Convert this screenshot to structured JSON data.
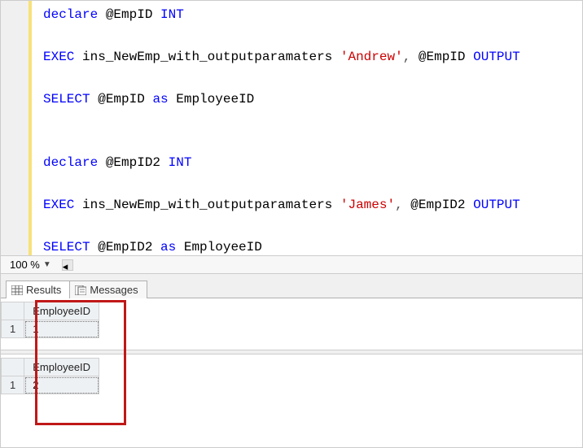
{
  "code": {
    "tokens": [
      [
        {
          "t": "declare ",
          "c": "kw"
        },
        {
          "t": "@EmpID ",
          "c": "var"
        },
        {
          "t": "INT",
          "c": "kw"
        }
      ],
      [],
      [
        {
          "t": "EXEC ",
          "c": "kw"
        },
        {
          "t": "ins_NewEmp_with_outputparamaters ",
          "c": "func"
        },
        {
          "t": "'Andrew'",
          "c": "str"
        },
        {
          "t": ", ",
          "c": "gray"
        },
        {
          "t": "@EmpID ",
          "c": "var"
        },
        {
          "t": "OUTPUT",
          "c": "kw"
        }
      ],
      [],
      [
        {
          "t": "SELECT ",
          "c": "kw"
        },
        {
          "t": "@EmpID ",
          "c": "var"
        },
        {
          "t": "as ",
          "c": "kw"
        },
        {
          "t": "EmployeeID",
          "c": "var"
        }
      ],
      [],
      [],
      [
        {
          "t": "declare ",
          "c": "kw"
        },
        {
          "t": "@EmpID2 ",
          "c": "var"
        },
        {
          "t": "INT",
          "c": "kw"
        }
      ],
      [],
      [
        {
          "t": "EXEC ",
          "c": "kw"
        },
        {
          "t": "ins_NewEmp_with_outputparamaters ",
          "c": "func"
        },
        {
          "t": "'James'",
          "c": "str"
        },
        {
          "t": ", ",
          "c": "gray"
        },
        {
          "t": "@EmpID2 ",
          "c": "var"
        },
        {
          "t": "OUTPUT",
          "c": "kw"
        }
      ],
      [],
      [
        {
          "t": "SELECT ",
          "c": "kw"
        },
        {
          "t": "@EmpID2 ",
          "c": "var"
        },
        {
          "t": "as ",
          "c": "kw"
        },
        {
          "t": "EmployeeID",
          "c": "var"
        }
      ]
    ]
  },
  "zoom": {
    "value": "100 %"
  },
  "tabs": {
    "results": "Results",
    "messages": "Messages"
  },
  "results": [
    {
      "column": "EmployeeID",
      "rownum": "1",
      "value": "1"
    },
    {
      "column": "EmployeeID",
      "rownum": "1",
      "value": "2"
    }
  ]
}
